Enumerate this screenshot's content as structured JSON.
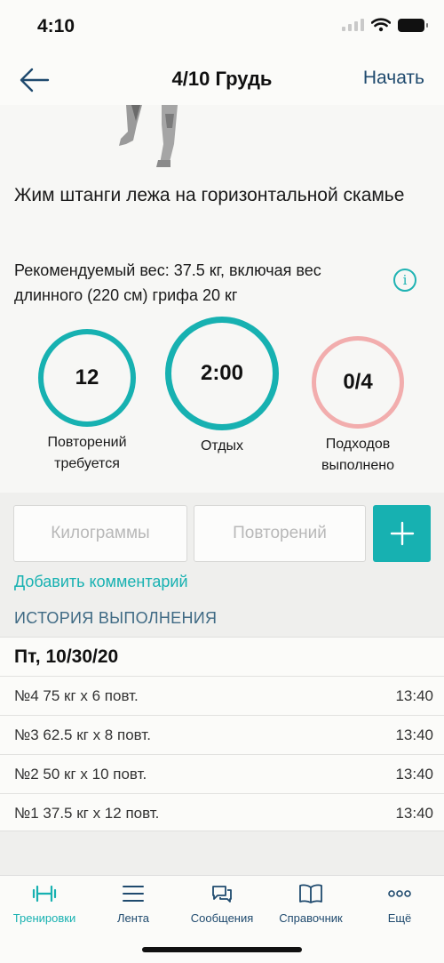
{
  "status": {
    "time": "4:10"
  },
  "nav": {
    "title": "4/10 Грудь",
    "start_label": "Начать"
  },
  "exercise": {
    "title": "Жим штанги лежа на горизонтальной скамье",
    "recommended": "Рекомендуемый вес: 37.5 кг, включая вес длинного (220 см) грифа 20 кг",
    "info_glyph": "i"
  },
  "stats": {
    "reps": {
      "value": "12",
      "label": "Повторений требуется"
    },
    "rest": {
      "value": "2:00",
      "label": "Отдых"
    },
    "sets": {
      "value": "0/4",
      "label": "Подходов выполнено"
    }
  },
  "inputs": {
    "kg_placeholder": "Килограммы",
    "reps_placeholder": "Повторений"
  },
  "add_comment": "Добавить комментарий",
  "history": {
    "header": "ИСТОРИЯ ВЫПОЛНЕНИЯ",
    "date": "Пт, 10/30/20",
    "rows": [
      {
        "entry": "№4 75 кг x 6 повт.",
        "time": "13:40"
      },
      {
        "entry": "№3 62.5 кг x 8 повт.",
        "time": "13:40"
      },
      {
        "entry": "№2 50 кг x 10 повт.",
        "time": "13:40"
      },
      {
        "entry": "№1 37.5 кг x 12 повт.",
        "time": "13:40"
      }
    ]
  },
  "tabs": [
    {
      "label": "Тренировки",
      "icon": "dumbbell-icon",
      "active": true
    },
    {
      "label": "Лента",
      "icon": "menu-icon",
      "active": false
    },
    {
      "label": "Сообщения",
      "icon": "chat-icon",
      "active": false
    },
    {
      "label": "Справочник",
      "icon": "book-icon",
      "active": false
    },
    {
      "label": "Ещё",
      "icon": "more-icon",
      "active": false
    }
  ],
  "colors": {
    "accent": "#17b1b1",
    "nav_blue": "#1f4a6e",
    "sets_ring": "#f2adad"
  }
}
